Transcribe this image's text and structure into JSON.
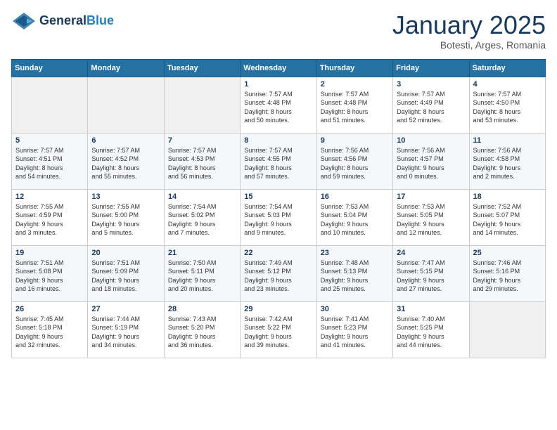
{
  "header": {
    "logo_line1": "General",
    "logo_line2": "Blue",
    "title": "January 2025",
    "subtitle": "Botesti, Arges, Romania"
  },
  "weekdays": [
    "Sunday",
    "Monday",
    "Tuesday",
    "Wednesday",
    "Thursday",
    "Friday",
    "Saturday"
  ],
  "weeks": [
    [
      {
        "day": "",
        "info": ""
      },
      {
        "day": "",
        "info": ""
      },
      {
        "day": "",
        "info": ""
      },
      {
        "day": "1",
        "info": "Sunrise: 7:57 AM\nSunset: 4:48 PM\nDaylight: 8 hours\nand 50 minutes."
      },
      {
        "day": "2",
        "info": "Sunrise: 7:57 AM\nSunset: 4:48 PM\nDaylight: 8 hours\nand 51 minutes."
      },
      {
        "day": "3",
        "info": "Sunrise: 7:57 AM\nSunset: 4:49 PM\nDaylight: 8 hours\nand 52 minutes."
      },
      {
        "day": "4",
        "info": "Sunrise: 7:57 AM\nSunset: 4:50 PM\nDaylight: 8 hours\nand 53 minutes."
      }
    ],
    [
      {
        "day": "5",
        "info": "Sunrise: 7:57 AM\nSunset: 4:51 PM\nDaylight: 8 hours\nand 54 minutes."
      },
      {
        "day": "6",
        "info": "Sunrise: 7:57 AM\nSunset: 4:52 PM\nDaylight: 8 hours\nand 55 minutes."
      },
      {
        "day": "7",
        "info": "Sunrise: 7:57 AM\nSunset: 4:53 PM\nDaylight: 8 hours\nand 56 minutes."
      },
      {
        "day": "8",
        "info": "Sunrise: 7:57 AM\nSunset: 4:55 PM\nDaylight: 8 hours\nand 57 minutes."
      },
      {
        "day": "9",
        "info": "Sunrise: 7:56 AM\nSunset: 4:56 PM\nDaylight: 8 hours\nand 59 minutes."
      },
      {
        "day": "10",
        "info": "Sunrise: 7:56 AM\nSunset: 4:57 PM\nDaylight: 9 hours\nand 0 minutes."
      },
      {
        "day": "11",
        "info": "Sunrise: 7:56 AM\nSunset: 4:58 PM\nDaylight: 9 hours\nand 2 minutes."
      }
    ],
    [
      {
        "day": "12",
        "info": "Sunrise: 7:55 AM\nSunset: 4:59 PM\nDaylight: 9 hours\nand 3 minutes."
      },
      {
        "day": "13",
        "info": "Sunrise: 7:55 AM\nSunset: 5:00 PM\nDaylight: 9 hours\nand 5 minutes."
      },
      {
        "day": "14",
        "info": "Sunrise: 7:54 AM\nSunset: 5:02 PM\nDaylight: 9 hours\nand 7 minutes."
      },
      {
        "day": "15",
        "info": "Sunrise: 7:54 AM\nSunset: 5:03 PM\nDaylight: 9 hours\nand 9 minutes."
      },
      {
        "day": "16",
        "info": "Sunrise: 7:53 AM\nSunset: 5:04 PM\nDaylight: 9 hours\nand 10 minutes."
      },
      {
        "day": "17",
        "info": "Sunrise: 7:53 AM\nSunset: 5:05 PM\nDaylight: 9 hours\nand 12 minutes."
      },
      {
        "day": "18",
        "info": "Sunrise: 7:52 AM\nSunset: 5:07 PM\nDaylight: 9 hours\nand 14 minutes."
      }
    ],
    [
      {
        "day": "19",
        "info": "Sunrise: 7:51 AM\nSunset: 5:08 PM\nDaylight: 9 hours\nand 16 minutes."
      },
      {
        "day": "20",
        "info": "Sunrise: 7:51 AM\nSunset: 5:09 PM\nDaylight: 9 hours\nand 18 minutes."
      },
      {
        "day": "21",
        "info": "Sunrise: 7:50 AM\nSunset: 5:11 PM\nDaylight: 9 hours\nand 20 minutes."
      },
      {
        "day": "22",
        "info": "Sunrise: 7:49 AM\nSunset: 5:12 PM\nDaylight: 9 hours\nand 23 minutes."
      },
      {
        "day": "23",
        "info": "Sunrise: 7:48 AM\nSunset: 5:13 PM\nDaylight: 9 hours\nand 25 minutes."
      },
      {
        "day": "24",
        "info": "Sunrise: 7:47 AM\nSunset: 5:15 PM\nDaylight: 9 hours\nand 27 minutes."
      },
      {
        "day": "25",
        "info": "Sunrise: 7:46 AM\nSunset: 5:16 PM\nDaylight: 9 hours\nand 29 minutes."
      }
    ],
    [
      {
        "day": "26",
        "info": "Sunrise: 7:45 AM\nSunset: 5:18 PM\nDaylight: 9 hours\nand 32 minutes."
      },
      {
        "day": "27",
        "info": "Sunrise: 7:44 AM\nSunset: 5:19 PM\nDaylight: 9 hours\nand 34 minutes."
      },
      {
        "day": "28",
        "info": "Sunrise: 7:43 AM\nSunset: 5:20 PM\nDaylight: 9 hours\nand 36 minutes."
      },
      {
        "day": "29",
        "info": "Sunrise: 7:42 AM\nSunset: 5:22 PM\nDaylight: 9 hours\nand 39 minutes."
      },
      {
        "day": "30",
        "info": "Sunrise: 7:41 AM\nSunset: 5:23 PM\nDaylight: 9 hours\nand 41 minutes."
      },
      {
        "day": "31",
        "info": "Sunrise: 7:40 AM\nSunset: 5:25 PM\nDaylight: 9 hours\nand 44 minutes."
      },
      {
        "day": "",
        "info": ""
      }
    ]
  ]
}
